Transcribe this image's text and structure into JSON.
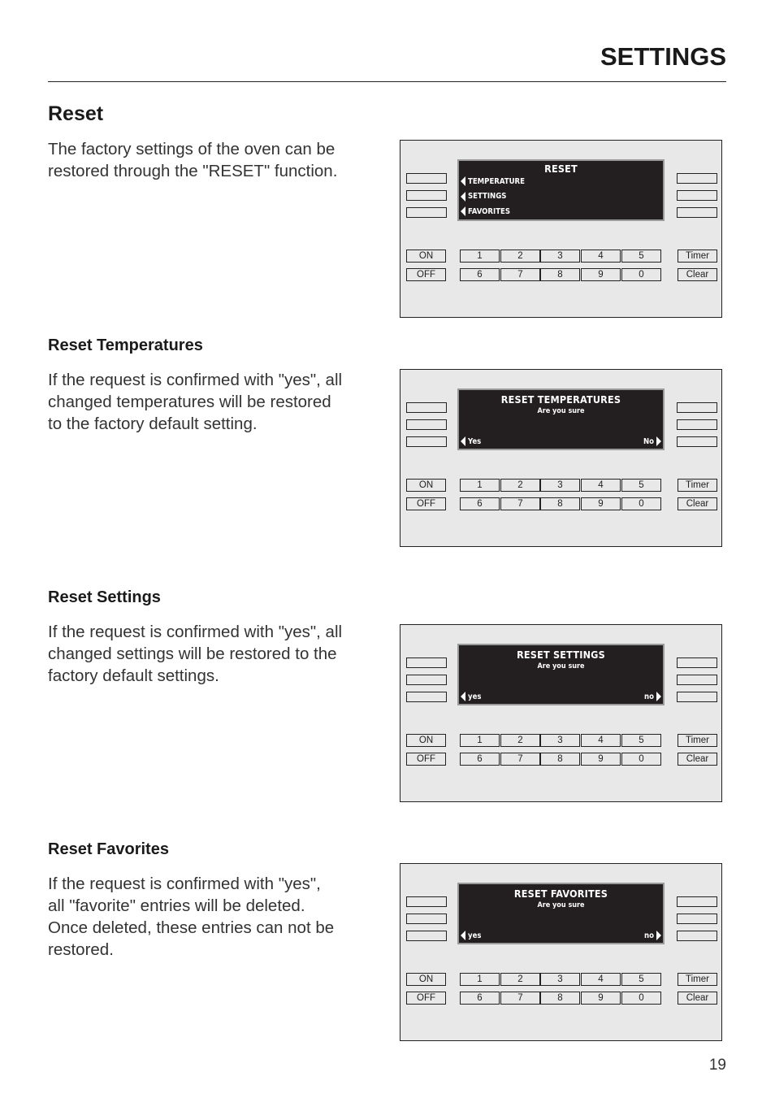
{
  "header": {
    "title": "SETTINGS"
  },
  "sections": [
    {
      "heading": "Reset",
      "body": [
        "The factory settings of the oven can be",
        "restored through the \"RESET\" function."
      ],
      "panel": {
        "screen": {
          "title": "RESET",
          "items": [
            "TEMPERATURE",
            "SETTINGS",
            "FAVORITES"
          ]
        }
      }
    },
    {
      "heading": "Reset Temperatures",
      "body": [
        "If the request is confirmed with \"yes\", all",
        "changed temperatures will be restored",
        "to the factory default setting."
      ],
      "panel": {
        "screen": {
          "title": "RESET TEMPERATURES",
          "subtitle": "Are you sure",
          "left": "Yes",
          "right": "No"
        }
      }
    },
    {
      "heading": "Reset Settings",
      "body": [
        "If the request is confirmed with \"yes\", all",
        "changed settings will be restored to the",
        "factory default settings."
      ],
      "panel": {
        "screen": {
          "title": "RESET SETTINGS",
          "subtitle": "Are you sure",
          "left": "yes",
          "right": "no"
        }
      }
    },
    {
      "heading": "Reset Favorites",
      "body": [
        "If the request is confirmed with \"yes\",",
        "all \"favorite\" entries will be deleted.",
        "Once deleted, these entries can not be",
        "restored."
      ],
      "panel": {
        "screen": {
          "title": "RESET FAVORITES",
          "subtitle": "Are you sure",
          "left": "yes",
          "right": "no"
        }
      }
    }
  ],
  "keypad": {
    "on": "ON",
    "off": "OFF",
    "row1": [
      "1",
      "2",
      "3",
      "4",
      "5"
    ],
    "row2": [
      "6",
      "7",
      "8",
      "9",
      "0"
    ],
    "timer": "Timer",
    "clear": "Clear"
  },
  "footer": {
    "page_number": "19"
  }
}
